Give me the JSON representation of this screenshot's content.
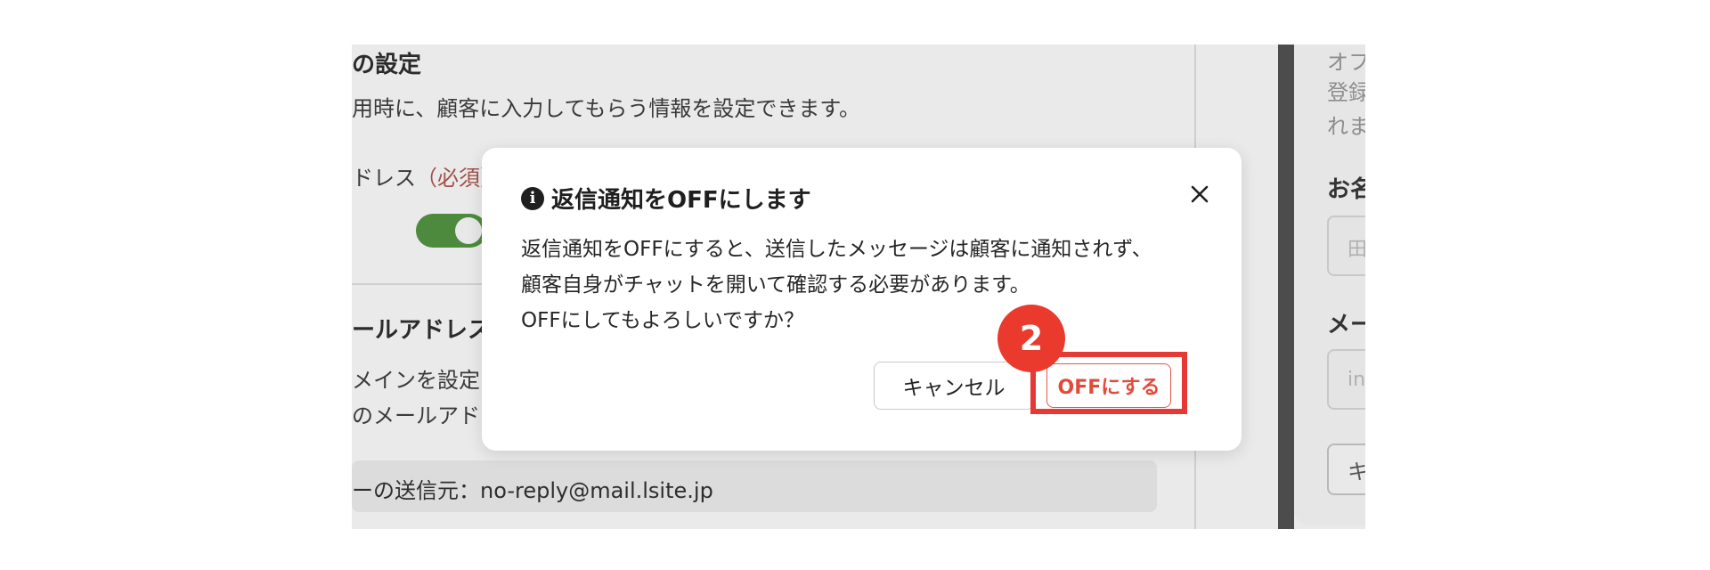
{
  "background": {
    "section_title": "の設定",
    "section_desc": "用時に、顧客に入力してもらう情報を設定できます。",
    "field_label": "ドレス",
    "field_required": "（必須）",
    "section2_title": "ールアドレス",
    "section2_desc_line1": "メインを設定し",
    "section2_desc_line2": "のメールアドレ",
    "sender_text": "ーの送信元：no-reply@mail.lsite.jp",
    "right_panel": {
      "line1": "オフ",
      "line2": "登録",
      "line3": "れま",
      "label_name": "お名",
      "input_name_placeholder": "田",
      "label_mail": "メー",
      "input_mail_placeholder": "in",
      "button_text": "キ"
    }
  },
  "dialog": {
    "title": "返信通知をOFFにします",
    "info_icon": "info-icon",
    "close_icon": "close-icon",
    "body_lines": [
      "返信通知をOFFにすると、送信したメッセージは顧客に通知されず、",
      "顧客自身がチャットを開いて確認する必要があります。",
      "OFFにしてもよろしいですか？"
    ],
    "cancel_label": "キャンセル",
    "confirm_label": "OFFにする"
  },
  "step_badge": "2",
  "colors": {
    "accent_red": "#e53935",
    "confirm_text": "#e24a3b",
    "toggle_green": "#4d8a3d"
  }
}
